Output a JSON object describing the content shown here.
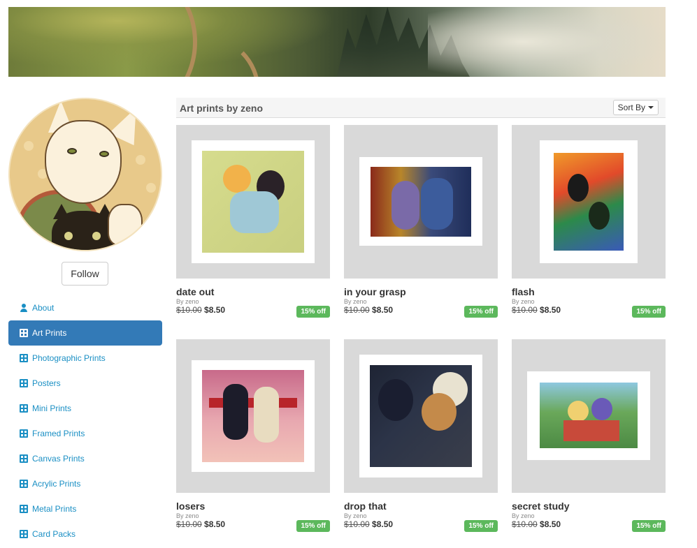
{
  "profile": {
    "follow_label": "Follow"
  },
  "sidebar": {
    "items": [
      {
        "label": "About",
        "icon": "user-icon"
      },
      {
        "label": "Art Prints",
        "icon": "grid-icon",
        "active": true
      },
      {
        "label": "Photographic Prints",
        "icon": "grid-icon"
      },
      {
        "label": "Posters",
        "icon": "grid-icon"
      },
      {
        "label": "Mini Prints",
        "icon": "grid-icon"
      },
      {
        "label": "Framed Prints",
        "icon": "grid-icon"
      },
      {
        "label": "Canvas Prints",
        "icon": "grid-icon"
      },
      {
        "label": "Acrylic Prints",
        "icon": "grid-icon"
      },
      {
        "label": "Metal Prints",
        "icon": "grid-icon"
      },
      {
        "label": "Card Packs",
        "icon": "grid-icon"
      }
    ]
  },
  "header": {
    "title": "Art prints by zeno",
    "sort_label": "Sort By"
  },
  "products": [
    {
      "title": "date out",
      "by": "By zeno",
      "old_price": "$10.00",
      "new_price": "$8.50",
      "badge": "15% off"
    },
    {
      "title": "in your grasp",
      "by": "By zeno",
      "old_price": "$10.00",
      "new_price": "$8.50",
      "badge": "15% off"
    },
    {
      "title": "flash",
      "by": "By zeno",
      "old_price": "$10.00",
      "new_price": "$8.50",
      "badge": "15% off"
    },
    {
      "title": "losers",
      "by": "By zeno",
      "old_price": "$10.00",
      "new_price": "$8.50",
      "badge": "15% off"
    },
    {
      "title": "drop that",
      "by": "By zeno",
      "old_price": "$10.00",
      "new_price": "$8.50",
      "badge": "15% off"
    },
    {
      "title": "secret study",
      "by": "By zeno",
      "old_price": "$10.00",
      "new_price": "$8.50",
      "badge": "15% off"
    }
  ],
  "colors": {
    "accent": "#337ab7",
    "link": "#1a8fc4",
    "badge": "#5cb85c",
    "thumb_bg": "#d9d9d9"
  }
}
